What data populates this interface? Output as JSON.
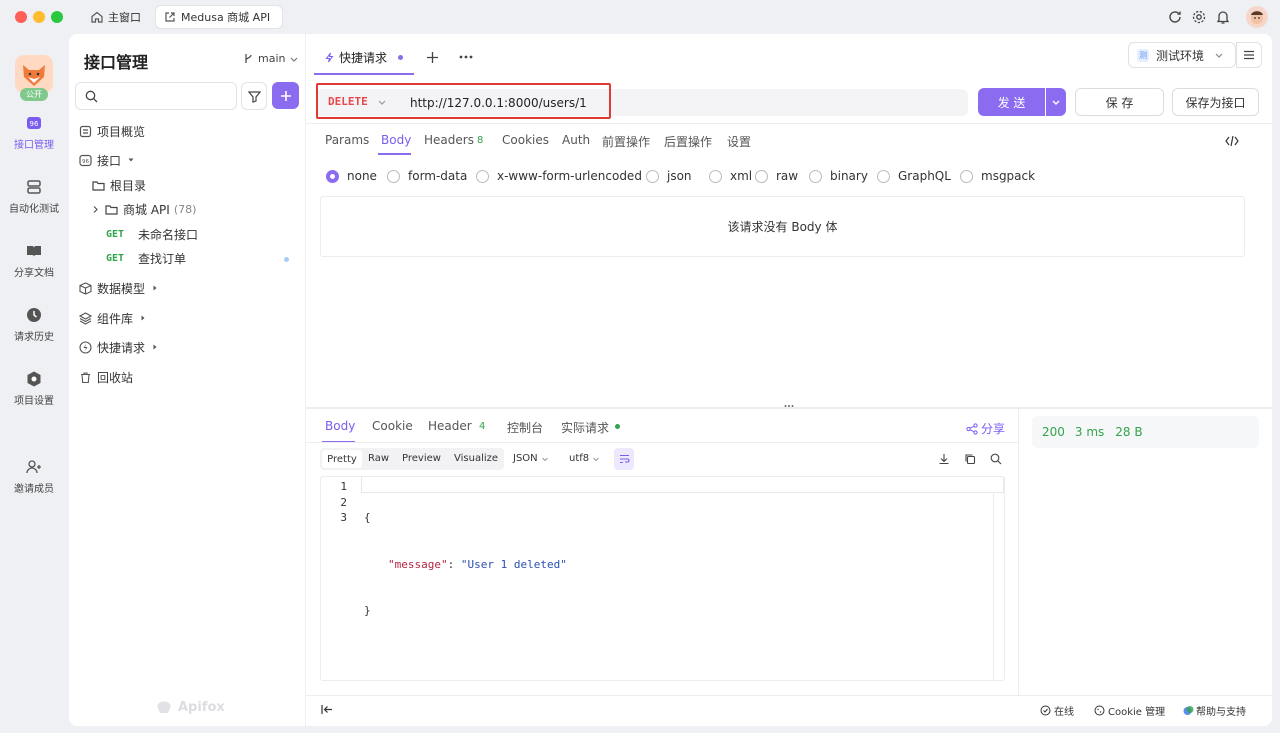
{
  "titlebar": {
    "home_tab": "主窗口",
    "active_tab": "Medusa 商城 API"
  },
  "rail": {
    "public_badge": "公开",
    "items": [
      {
        "label": "接口管理"
      },
      {
        "label": "自动化测试"
      },
      {
        "label": "分享文档"
      },
      {
        "label": "请求历史"
      },
      {
        "label": "项目设置"
      },
      {
        "label": "邀请成员"
      }
    ]
  },
  "sidebar": {
    "title": "接口管理",
    "branch": "main",
    "search_placeholder": "",
    "overview": "项目概览",
    "interfaces": "接口",
    "root_dir": "根目录",
    "folder_name": "商城 API",
    "folder_count": "(78)",
    "endpoints": [
      {
        "method": "GET",
        "name": "未命名接口"
      },
      {
        "method": "GET",
        "name": "查找订单"
      }
    ],
    "data_models": "数据模型",
    "components": "组件库",
    "quick_requests": "快捷请求",
    "recycle": "回收站",
    "watermark": "Apifox"
  },
  "main": {
    "tab_label": "快捷请求",
    "env_badge": "测",
    "env_label": "测试环境",
    "method": "DELETE",
    "url": "http://127.0.0.1:8000/users/1",
    "send": "发 送",
    "save": "保 存",
    "save_as": "保存为接口",
    "req_tabs": [
      "Params",
      "Body",
      "Headers",
      "Cookies",
      "Auth",
      "前置操作",
      "后置操作",
      "设置"
    ],
    "headers_count": "8",
    "body_types": [
      "none",
      "form-data",
      "x-www-form-urlencoded",
      "json",
      "xml",
      "raw",
      "binary",
      "GraphQL",
      "msgpack"
    ],
    "no_body": "该请求没有 Body 体"
  },
  "response": {
    "tabs": [
      "Body",
      "Cookie",
      "Header",
      "控制台",
      "实际请求"
    ],
    "header_count": "4",
    "share": "分享",
    "views": [
      "Pretty",
      "Raw",
      "Preview",
      "Visualize"
    ],
    "format": "JSON",
    "encoding": "utf8",
    "line_numbers": [
      "1",
      "2",
      "3"
    ],
    "line1": "{",
    "key": "\"message\"",
    "colon": ": ",
    "value": "\"User 1 deleted\"",
    "line3": "}",
    "status": "200",
    "time": "3 ms",
    "size": "28 B"
  },
  "statusbar": {
    "online": "在线",
    "cookie_mgr": "Cookie 管理",
    "help": "帮助与支持"
  },
  "colors": {
    "accent": "#8b6cf0",
    "delete": "#e5484d",
    "get": "#33a34c",
    "highlight_box": "#e03b32"
  }
}
